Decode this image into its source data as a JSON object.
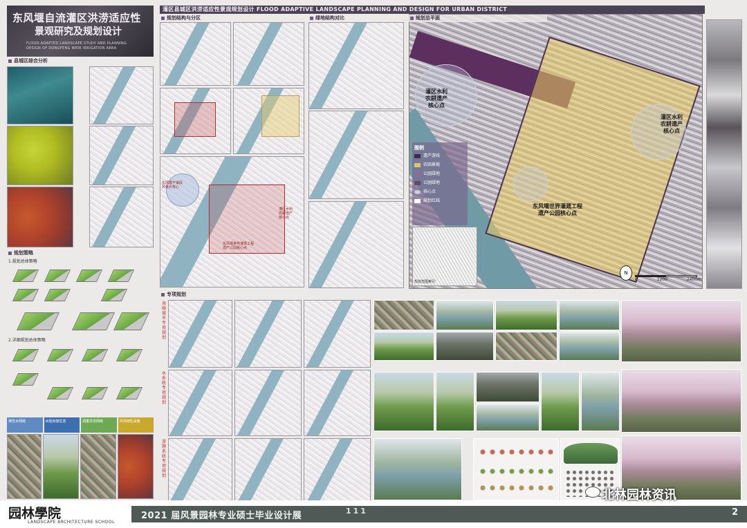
{
  "title": {
    "line1": "东风堰自流灌区洪涝适应性",
    "line2": "景观研究及规划设计",
    "en1": "FLOOD-ADAPTED LANDSCAPE STUDY AND PLANNING",
    "en2": "DESIGN OF DONGFENG WEIR IRRIGATION AREA"
  },
  "header_band": "灌区县城区洪涝适应性景观规划设计 FLOOD ADAPTIVE LANDSCAPE PLANNING AND DESIGN FOR URBAN DISTRICT",
  "sections": {
    "county_analysis": "县城区综合分析",
    "planning_strategy": "规划策略",
    "structure_zoning": "规划结构与分区",
    "green_comparison": "绿地结构对比",
    "master_plan": "规划总平面",
    "special_planning": "专项规划"
  },
  "strategy": {
    "item1": "1.规划总体策略",
    "item2": "2.详细规划总体策略",
    "cards": [
      "弹性水网络",
      "水陆衔接生态",
      "调蓄洪涝网络",
      "洪涝韧性设施"
    ]
  },
  "master_labels": {
    "west_core": "灌区水利\n农耕遗产\n核心点",
    "east_core": "灌区水利\n农耕遗产\n核心点",
    "south_core": "东风堰世界灌溉工程\n遗产公园核心点"
  },
  "structure_labels": {
    "left": "东风堰干渠段\n风景片核心",
    "right": "灌区水利\n农耕遗产\n核心点",
    "center": "东风堰世界灌溉工程\n遗产公园核心点"
  },
  "legend": {
    "title": "图例",
    "items": [
      {
        "label": "遗产游线",
        "color": "#3d2a48"
      },
      {
        "label": "农田景观",
        "color": "#e2c46a"
      },
      {
        "label": "公园绿地",
        "color": "#8a6ca0"
      },
      {
        "label": "公园绿地",
        "color": "#5e4d68"
      },
      {
        "label": "核心点",
        "color": "#c6d0e4"
      },
      {
        "label": "规划红线",
        "color": "#ffffff"
      }
    ]
  },
  "north_label": "N",
  "scale_labels": [
    "0",
    "1200",
    "2400m"
  ],
  "inset_caption": "规划范围索引",
  "special_vertical": [
    "海绵城市专项规划",
    "水系统专项规划",
    "游憩系统专项规划"
  ],
  "footer": {
    "logo": "园林學院",
    "logo_sub": "LANDSCAPE ARCHITECTURE SCHOOL",
    "exhibit": "2021 届风景园林专业硕士毕业设计展",
    "stripes": "111",
    "page": "2",
    "brand": "北林园林资讯"
  },
  "colors": {
    "header_band": "#4b4256",
    "footer_band": "#4f5a56",
    "accent_purple": "#5d2f5f",
    "river": "#6f9aa6"
  }
}
